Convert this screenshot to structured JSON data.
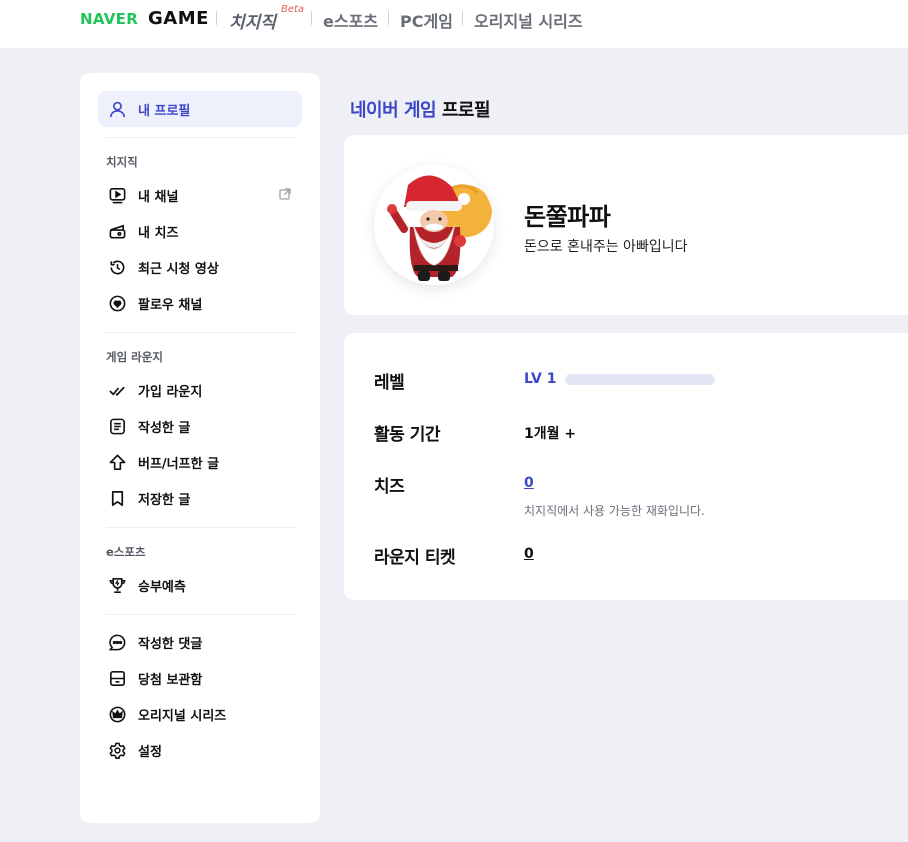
{
  "header": {
    "naver_logo": "NAVER",
    "game_logo": "GAME",
    "chzzk_logo": "치지직",
    "beta_label": "Beta",
    "nav": [
      {
        "label": "e스포츠"
      },
      {
        "label": "PC게임"
      },
      {
        "label": "오리지널 시리즈"
      }
    ]
  },
  "sidebar": {
    "my_profile": "내 프로필",
    "sections": {
      "chzzk": "치지직",
      "lounge": "게임 라운지",
      "esports": "e스포츠"
    },
    "items": {
      "my_channel": "내 채널",
      "my_cheese": "내 치즈",
      "recent_videos": "최근 시청 영상",
      "follow_channels": "팔로우 채널",
      "joined_lounge": "가입 라운지",
      "my_posts": "작성한 글",
      "buff_nerf_posts": "버프/너프한 글",
      "saved_posts": "저장한 글",
      "match_prediction": "승부예측",
      "my_comments": "작성한 댓글",
      "prize_box": "당첨 보관함",
      "original_series": "오리지널 시리즈",
      "settings": "설정"
    }
  },
  "main": {
    "title_brand": "네이버 게임",
    "title_rest": "프로필",
    "profile": {
      "nickname": "돈쭐파파",
      "bio": "돈으로 혼내주는 아빠입니다"
    },
    "info": {
      "level_label": "레벨",
      "level_value": "LV 1",
      "level_progress": 0,
      "period_label": "활동 기간",
      "period_value": "1개월 +",
      "cheese_label": "치즈",
      "cheese_value": "0",
      "cheese_note": "치지직에서 사용 가능한 재화입니다.",
      "ticket_label": "라운지 티켓",
      "ticket_value": "0"
    }
  },
  "colors": {
    "accent": "#3c48c8",
    "naver_green": "#21c35b",
    "background": "#eef0f5"
  }
}
